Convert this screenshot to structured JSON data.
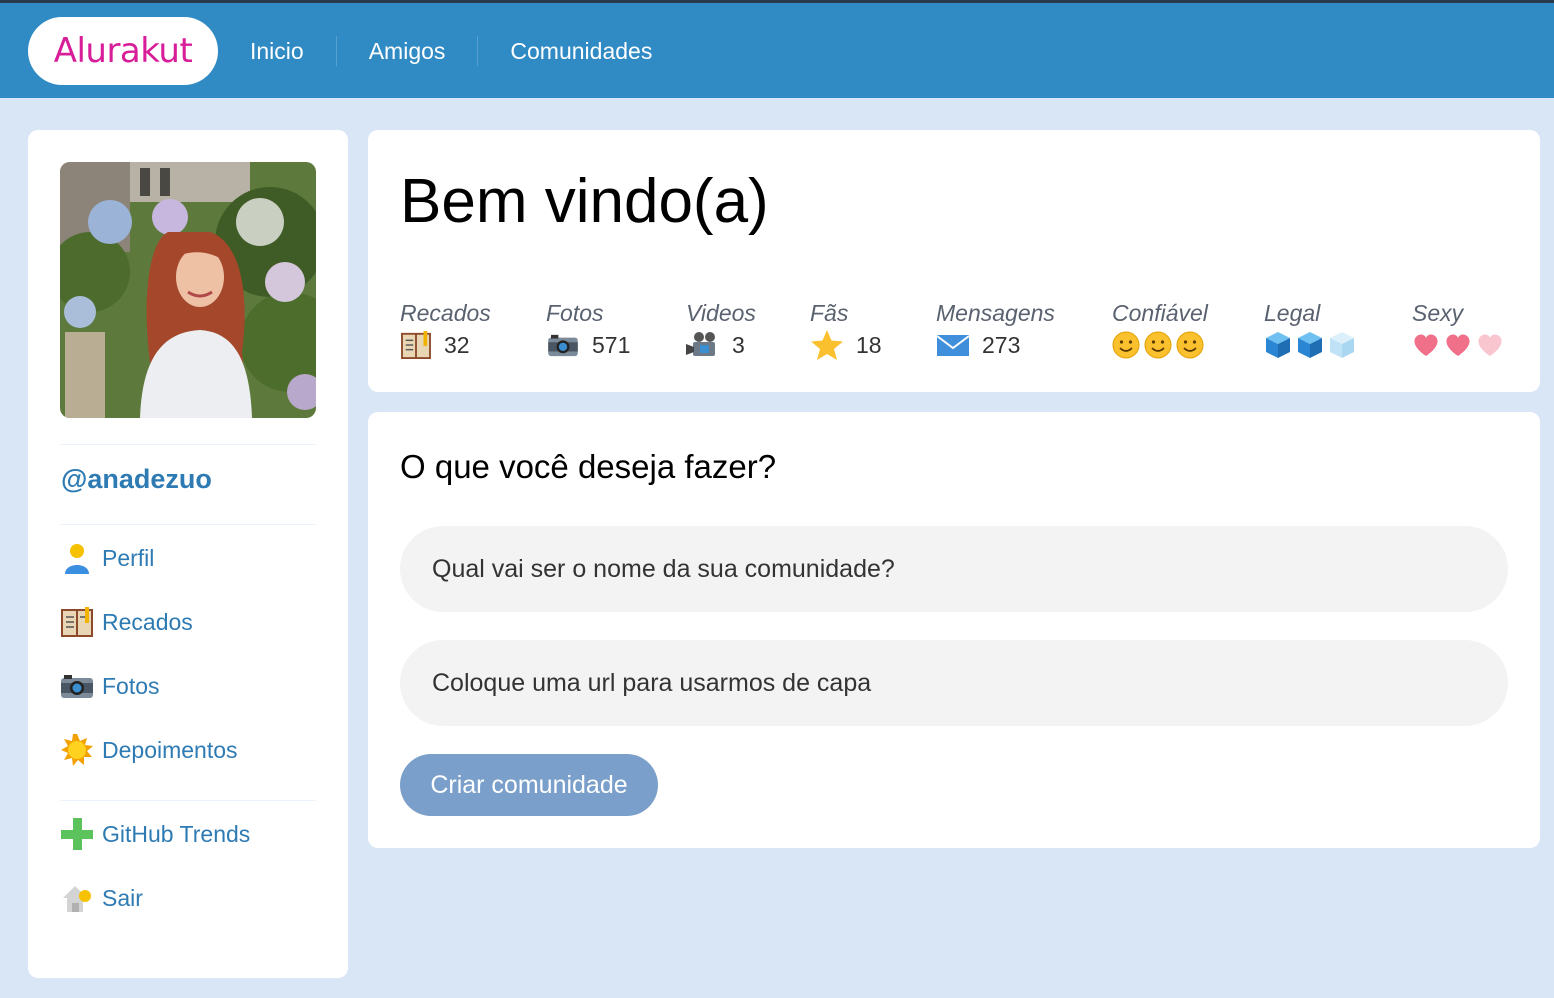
{
  "header": {
    "logo_text": "Alurakut",
    "nav": [
      {
        "label": "Inicio"
      },
      {
        "label": "Amigos"
      },
      {
        "label": "Comunidades"
      }
    ]
  },
  "sidebar": {
    "username": "@anadezuo",
    "items": [
      {
        "label": "Perfil",
        "icon": "user-icon"
      },
      {
        "label": "Recados",
        "icon": "notebook-icon"
      },
      {
        "label": "Fotos",
        "icon": "camera-icon"
      },
      {
        "label": "Depoimentos",
        "icon": "sun-icon"
      },
      {
        "label": "GitHub Trends",
        "icon": "plus-icon"
      },
      {
        "label": "Sair",
        "icon": "logout-house-icon"
      }
    ]
  },
  "welcome": {
    "title": "Bem vindo(a)",
    "stats": [
      {
        "label": "Recados",
        "value": "32",
        "icon": "notebook-icon"
      },
      {
        "label": "Fotos",
        "value": "571",
        "icon": "camera-icon"
      },
      {
        "label": "Videos",
        "value": "3",
        "icon": "video-camera-icon"
      },
      {
        "label": "Fãs",
        "value": "18",
        "icon": "star-icon"
      },
      {
        "label": "Mensagens",
        "value": "273",
        "icon": "envelope-icon"
      }
    ],
    "ratings": [
      {
        "label": "Confiável",
        "icon": "smiley-icon",
        "level": 3,
        "max": 3
      },
      {
        "label": "Legal",
        "icon": "cube-icon",
        "level": 2,
        "max": 3
      },
      {
        "label": "Sexy",
        "icon": "heart-icon",
        "level": 2,
        "max": 3
      }
    ]
  },
  "form": {
    "title": "O que você deseja fazer?",
    "name_placeholder": "Qual vai ser o nome da sua comunidade?",
    "url_placeholder": "Coloque uma url para usarmos de capa",
    "submit_label": "Criar comunidade"
  },
  "colors": {
    "header_bg": "#308bc5",
    "page_bg": "#d9e6f6",
    "logo": "#d81d99",
    "link": "#2e7bb4",
    "button": "#7a9fca"
  }
}
